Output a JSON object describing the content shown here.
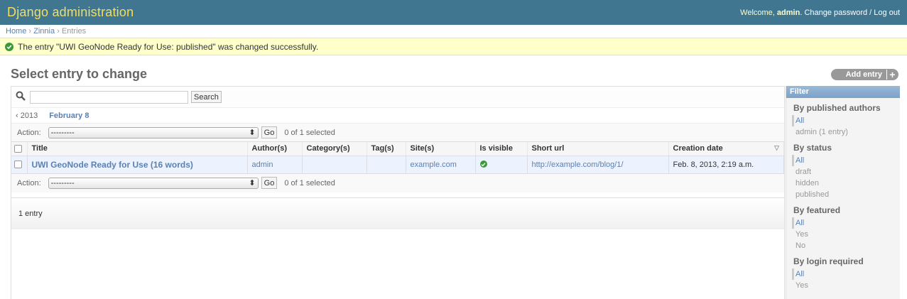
{
  "header": {
    "site_name": "Django administration",
    "welcome": "Welcome,",
    "user": "admin",
    "change_password": "Change password",
    "separator": "/",
    "log_out": "Log out"
  },
  "breadcrumbs": {
    "home": "Home",
    "app": "Zinnia",
    "current": "Entries",
    "sep": "›"
  },
  "message": "The entry \"UWI GeoNode Ready for Use: published\" was changed successfully.",
  "page_title": "Select entry to change",
  "add_entry": "Add entry",
  "search": {
    "value": "",
    "button": "Search"
  },
  "date_hierarchy": {
    "back": "‹ 2013",
    "current": "February 8"
  },
  "actions": {
    "label": "Action:",
    "selected": "---------",
    "go": "Go",
    "counter": "0 of 1 selected"
  },
  "table": {
    "headers": [
      "Title",
      "Author(s)",
      "Category(s)",
      "Tag(s)",
      "Site(s)",
      "Is visible",
      "Short url",
      "Creation date"
    ],
    "rows": [
      {
        "title": "UWI GeoNode Ready for Use (16 words)",
        "authors": "admin",
        "categories": "",
        "tags": "",
        "sites": "example.com",
        "is_visible": "yes-icon",
        "short_url": "http://example.com/blog/1/",
        "creation_date": "Feb. 8, 2013, 2:19 a.m."
      }
    ]
  },
  "paginator": "1 entry",
  "filter": {
    "title": "Filter",
    "groups": [
      {
        "heading": "By published authors",
        "options": [
          "All",
          "admin (1 entry)"
        ]
      },
      {
        "heading": "By status",
        "options": [
          "All",
          "draft",
          "hidden",
          "published"
        ]
      },
      {
        "heading": "By featured",
        "options": [
          "All",
          "Yes",
          "No"
        ]
      },
      {
        "heading": "By login required",
        "options": [
          "All",
          "Yes"
        ]
      }
    ]
  },
  "colors": {
    "header_bg": "#417690",
    "site_name": "#f5dd5d",
    "link": "#5b80b2",
    "message_bg": "#ffffcc",
    "success": "#3a9a3a"
  }
}
